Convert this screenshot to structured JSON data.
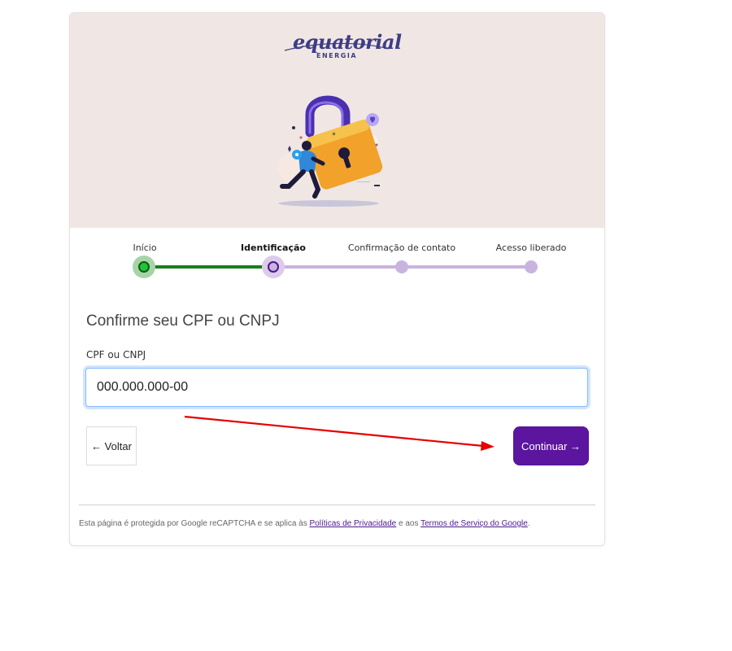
{
  "brand": {
    "logo_text": "equatorial",
    "logo_subtext": "ENERGIA",
    "primary_color": "#5b159e",
    "success_color": "#1d7d1d"
  },
  "stepper": {
    "steps": [
      {
        "label": "Início",
        "state": "done"
      },
      {
        "label": "Identificação",
        "state": "active"
      },
      {
        "label": "Confirmação de contato",
        "state": "pending"
      },
      {
        "label": "Acesso liberado",
        "state": "pending"
      }
    ]
  },
  "form": {
    "heading": "Confirme seu CPF ou CNPJ",
    "field_label": "CPF ou CNPJ",
    "field_value": "000.000.000-00"
  },
  "actions": {
    "back_label": "← Voltar",
    "continue_label": "Continuar →"
  },
  "footer": {
    "text_before": "Esta página é protegida por Google reCAPTCHA e se aplica às ",
    "privacy_link": "Políticas de Privacidade",
    "text_middle": " e aos ",
    "terms_link": "Termos de Serviço do Google",
    "text_after": "."
  }
}
